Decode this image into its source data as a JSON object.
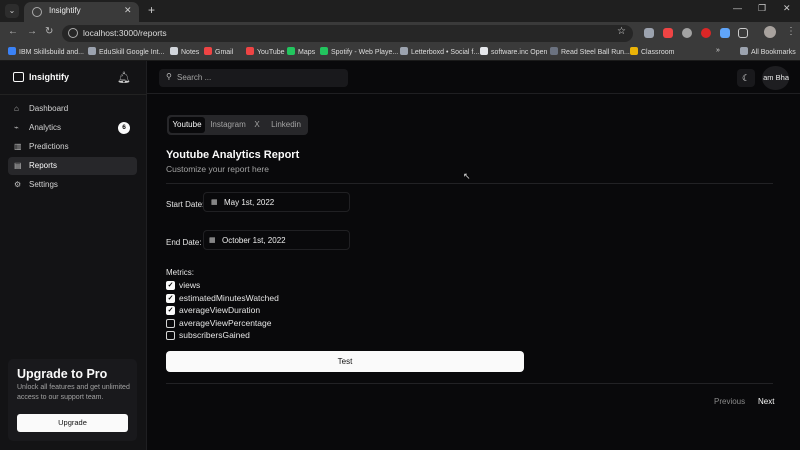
{
  "browser": {
    "tab_title": "Insightify",
    "url": "localhost:3000/reports",
    "bookmarks": [
      {
        "label": "IBM Skillsbuild and...",
        "color": "#3b82f6"
      },
      {
        "label": "EduSkill Google Int...",
        "color": "#9ca3af"
      },
      {
        "label": "Notes",
        "color": "#d1d5db"
      },
      {
        "label": "Gmail",
        "color": "#ef4444"
      },
      {
        "label": "YouTube",
        "color": "#ef4444"
      },
      {
        "label": "Maps",
        "color": "#22c55e"
      },
      {
        "label": "Spotify - Web Playe...",
        "color": "#22c55e"
      },
      {
        "label": "Letterboxd • Social f...",
        "color": "#9ca3af"
      },
      {
        "label": "software.inc Open",
        "color": "#e5e7eb"
      },
      {
        "label": "Read Steel Ball Run...",
        "color": "#6b7280"
      },
      {
        "label": "Classroom",
        "color": "#eab308"
      }
    ],
    "all_bookmarks": "All Bookmarks"
  },
  "sidebar": {
    "brand": "Insightify",
    "items": [
      {
        "label": "Dashboard",
        "icon": "home-icon"
      },
      {
        "label": "Analytics",
        "icon": "chart-icon",
        "badge": "6"
      },
      {
        "label": "Predictions",
        "icon": "bar-chart-icon"
      },
      {
        "label": "Reports",
        "icon": "clipboard-icon",
        "active": true
      },
      {
        "label": "Settings",
        "icon": "gear-icon"
      }
    ],
    "upgrade": {
      "title": "Upgrade to Pro",
      "text": "Unlock all features and get unlimited access to our support team.",
      "button": "Upgrade"
    }
  },
  "topbar": {
    "search_placeholder": "Search ...",
    "avatar_text": "am Bha"
  },
  "report": {
    "platform_tabs": [
      "Youtube",
      "Instagram",
      "X",
      "Linkedin"
    ],
    "active_platform": "Youtube",
    "title": "Youtube Analytics Report",
    "subtitle": "Customize your report here",
    "start_label": "Start Date:",
    "start_date": "May 1st, 2022",
    "end_label": "End Date:",
    "end_date": "October 1st, 2022",
    "metrics_label": "Metrics:",
    "metrics": [
      {
        "label": "views",
        "checked": true
      },
      {
        "label": "estimatedMinutesWatched",
        "checked": true
      },
      {
        "label": "averageViewDuration",
        "checked": true
      },
      {
        "label": "averageViewPercentage",
        "checked": false
      },
      {
        "label": "subscribersGained",
        "checked": false
      }
    ],
    "test_button": "Test",
    "prev": "Previous",
    "next": "Next"
  }
}
